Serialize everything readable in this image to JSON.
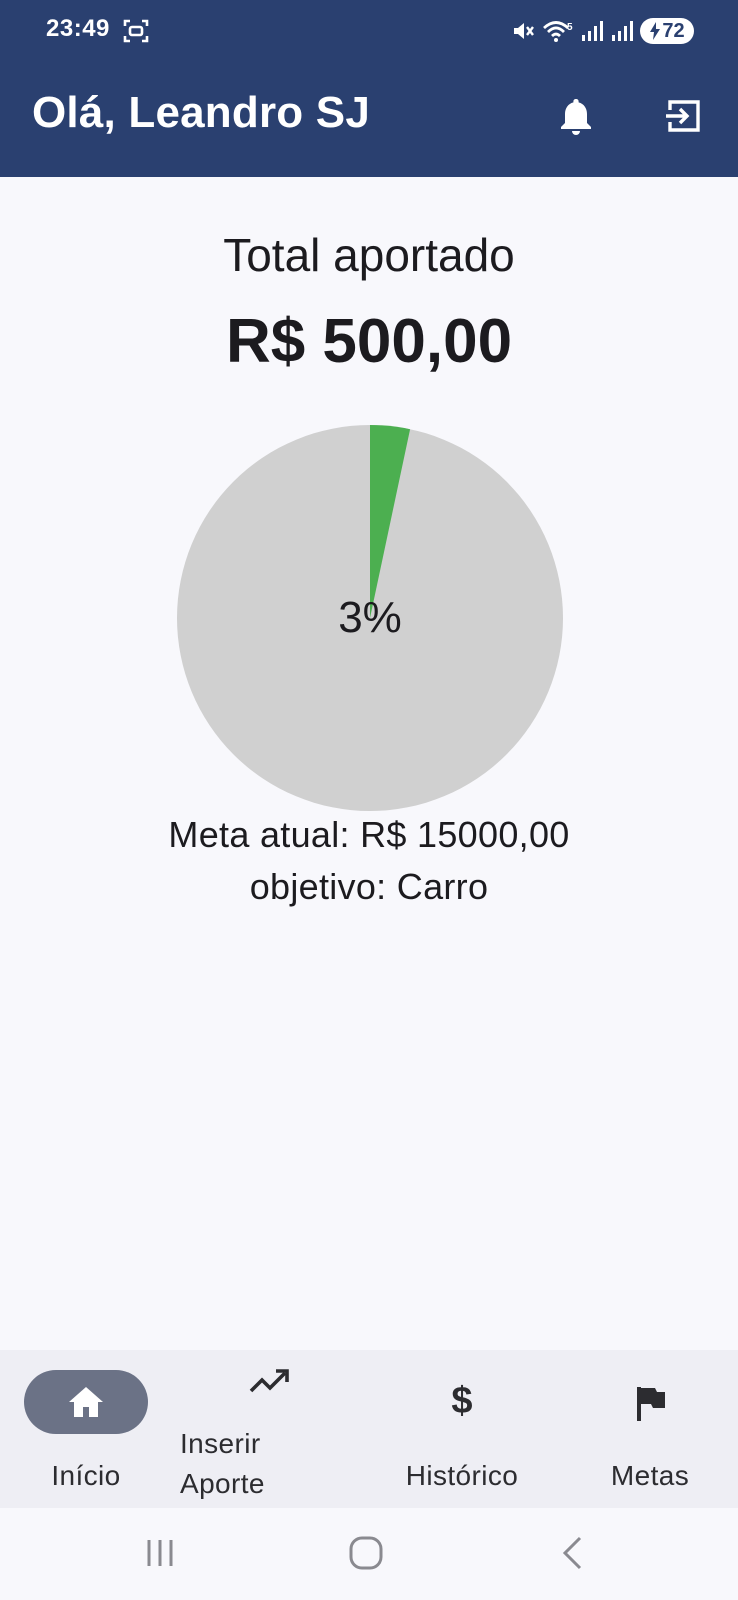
{
  "status_bar": {
    "time": "23:49",
    "battery_level": "72",
    "icons": [
      "screen-record-icon",
      "mute-icon",
      "wifi-icon",
      "signal-icon",
      "signal-icon",
      "battery-charging-icon"
    ]
  },
  "header": {
    "title": "Olá, Leandro SJ",
    "icons": [
      "bell-icon",
      "logout-icon"
    ],
    "background_color": "#2a4070"
  },
  "summary": {
    "total_label": "Total aportado",
    "total_value": "R$ 500,00",
    "goal_amount": "Meta atual: R$ 15000,00",
    "goal_objective": "objetivo: Carro"
  },
  "progress_chart": {
    "label": "3%",
    "progress_fraction": 0.0333,
    "fill_color": "#4caf50",
    "remaining_color": "#d0d0d0"
  },
  "bottom_nav": {
    "items": [
      {
        "label": "Início",
        "icon": "home-icon",
        "active": true
      },
      {
        "label": "Inserir\nAporte",
        "icon": "trending-up-icon",
        "active": false
      },
      {
        "label": "Histórico",
        "icon": "dollar-icon",
        "symbol": "$",
        "active": false
      },
      {
        "label": "Metas",
        "icon": "flag-icon",
        "active": false
      }
    ]
  },
  "system_nav": {
    "buttons": [
      "recent-apps-icon",
      "home-circle-icon",
      "back-icon"
    ]
  }
}
